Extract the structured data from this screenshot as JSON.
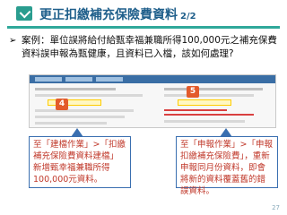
{
  "slide": {
    "title": "更正扣繳補充保險費資料",
    "page_indicator": "2/2",
    "question_marker": "➢",
    "question": "案例：單位誤將給付給甄幸福兼職所得100,000元之補充保費資料誤申報為甄健康，且資料已入檔，該如何處理?",
    "callouts": [
      {
        "number": "4",
        "text": "至「建檔作業」>「扣繳補充保險費資料建檔」新增甄幸福兼職所得100,000元資料。"
      },
      {
        "number": "5",
        "text": "至「申報作業」>「申報扣繳補充保險費」，重新申報同月份資料，即會將新的資料覆蓋舊的錯誤資料。"
      }
    ],
    "page_number": "27"
  },
  "colors": {
    "title": "#1f5f8b",
    "rule": "#2fa89a",
    "callout_text": "#c0392b",
    "callout_border": "#3a6fb0",
    "badge": "#e35b2b"
  }
}
